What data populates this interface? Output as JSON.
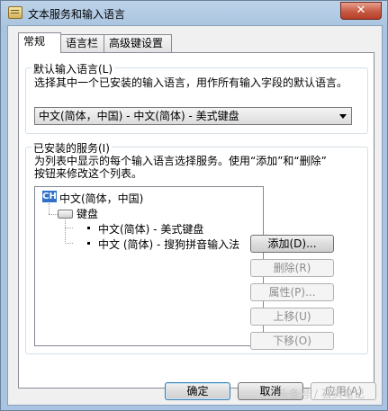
{
  "window": {
    "title": "文本服务和输入语言",
    "close_symbol": "✕"
  },
  "tabs": [
    {
      "label": "常规"
    },
    {
      "label": "语言栏"
    },
    {
      "label": "高级键设置"
    }
  ],
  "default_language": {
    "group_label": "默认输入语言(L)",
    "description": "选择其中一个已安装的输入语言，用作所有输入字段的默认语言。",
    "selected": "中文(简体，中国) - 中文(简体) - 美式键盘"
  },
  "installed_services": {
    "group_label": "已安装的服务(I)",
    "description_line1": "为列表中显示的每个输入语言选择服务。使用“添加”和“删除”",
    "description_line2": "按钮来修改这个列表。",
    "tree": {
      "language_code": "CH",
      "language": "中文(简体，中国)",
      "category": "键盘",
      "items": [
        "中文(简体) - 美式键盘",
        "中文 (简体) - 搜狗拼音输入法"
      ]
    },
    "buttons": {
      "add": "添加(D)...",
      "remove": "删除(R)",
      "properties": "属性(P)...",
      "move_up": "上移(U)",
      "move_down": "下移(O)"
    }
  },
  "footer": {
    "ok": "确定",
    "cancel": "取消",
    "apply": "应用(A)",
    "watermark": "头条号 / 石头笔记"
  }
}
